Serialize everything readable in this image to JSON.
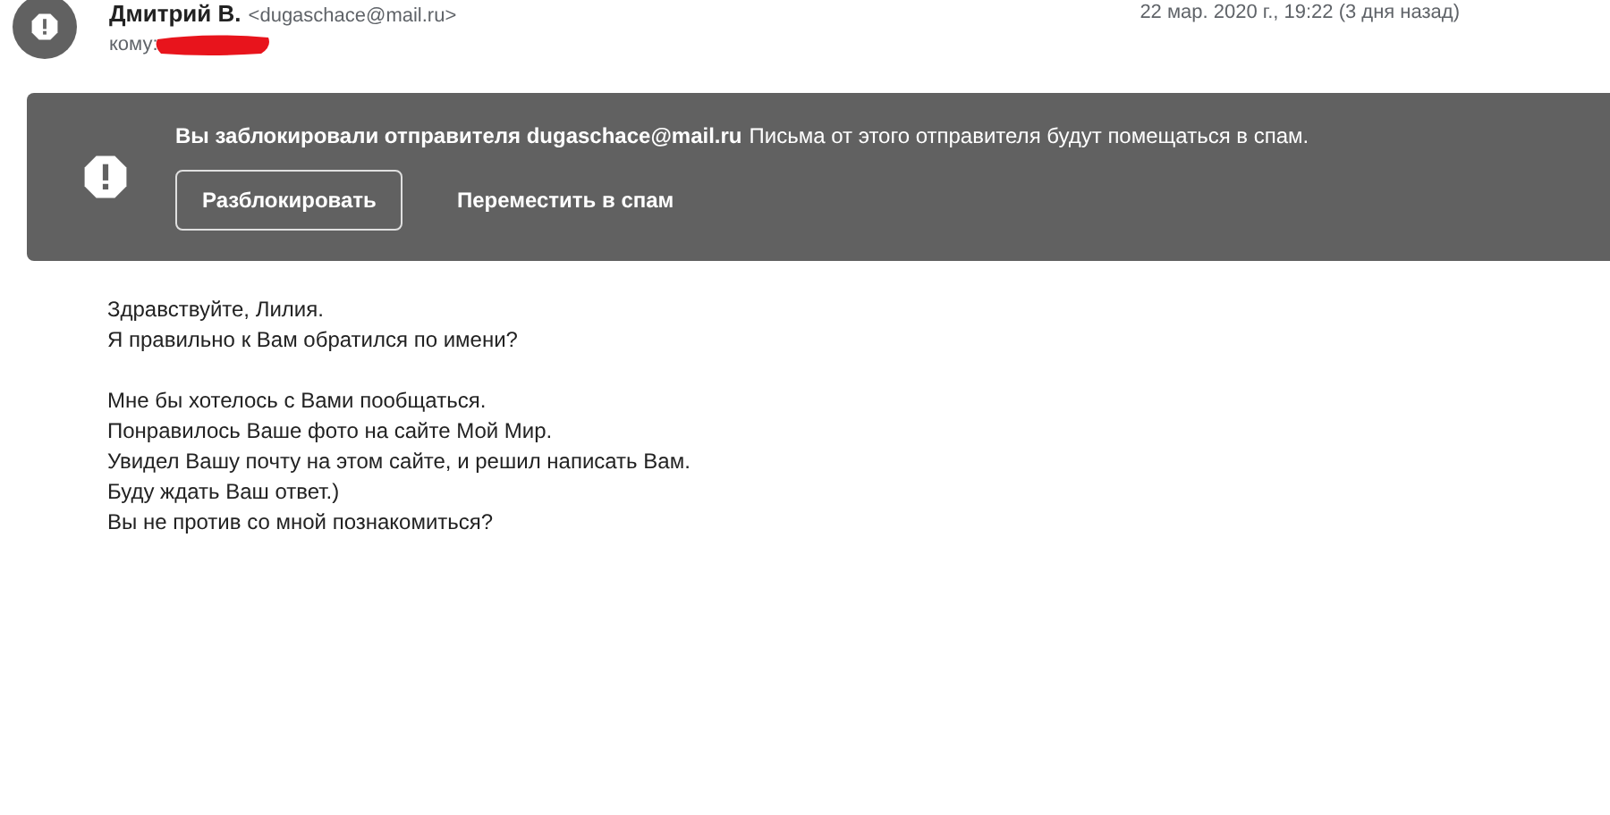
{
  "header": {
    "sender_name": "Дмитрий В.",
    "sender_email": "<dugaschace@mail.ru>",
    "to_label": "кому:",
    "date": "22 мар. 2020 г., 19:22 (3 дня назад)"
  },
  "banner": {
    "title": "Вы заблокировали отправителя dugaschace@mail.ru",
    "text": "Письма от этого отправителя будут помещаться в спам.",
    "buttons": [
      {
        "label": "Разблокировать",
        "kind": "outlined"
      },
      {
        "label": "Переместить в спам",
        "kind": "text"
      }
    ]
  },
  "body": {
    "paragraphs": [
      [
        "Здравствуйте, Лилия.",
        "Я правильно к Вам обратился по имени?"
      ],
      [
        "Мне бы хотелось с Вами пообщаться.",
        "Понравилось Ваше фото на сайте Мой Мир.",
        "Увидел Вашу почту на этом сайте, и решил написать Вам.",
        "Буду ждать Ваш ответ.)",
        "Вы не против со мной познакомиться?"
      ]
    ]
  }
}
